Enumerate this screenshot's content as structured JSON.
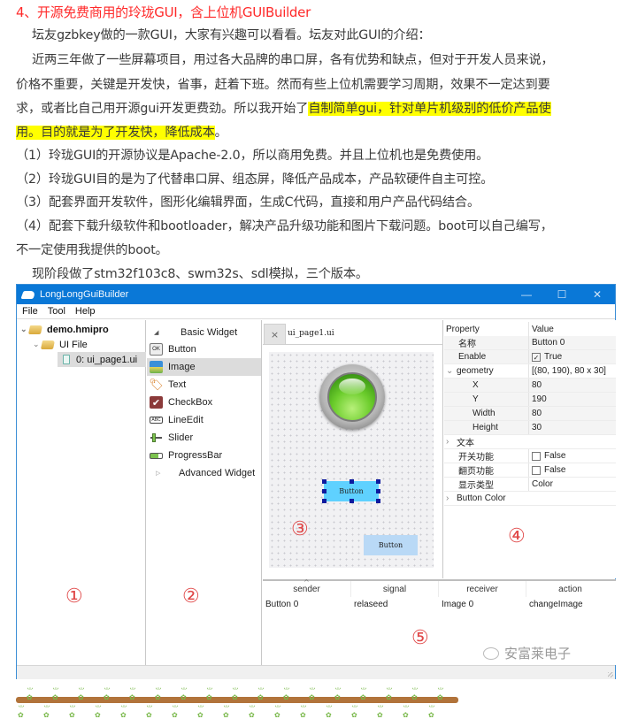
{
  "article": {
    "heading": "4、开源免费商用的玲珑GUI，含上位机GUIBuilder",
    "paragraphs": {
      "intro": "坛友gzbkey做的一款GUI，大家有兴趣可以看看。坛友对此GUI的介绍：",
      "body_line1": "近两三年做了一些屏幕项目，用过各大品牌的串口屏，各有优势和缺点，但对于开发人员来说，",
      "body_line2": "价格不重要，关键是开发快，省事，赶着下班。然而有些上位机需要学习周期，效果不一定达到要",
      "body_line3_plain": "求，或者比自己用开源gui开发更费劲。所以我开始了",
      "body_line3_highlight": "自制简单gui，针对单片机级别的低价产品使",
      "body_line4_highlight": "用。目的就是为了开发快，降低成本",
      "body_line4_end": "。",
      "item1": "（1）玲珑GUI的开源协议是Apache-2.0，所以商用免费。并且上位机也是免费使用。",
      "item2": "（2）玲珑GUI目的是为了代替串口屏、组态屏，降低产品成本，产品软硬件自主可控。",
      "item3": "（3）配套界面开发软件，图形化编辑界面，生成C代码，直接和用户产品代码结合。",
      "item4_line1": "（4）配套下载升级软件和bootloader，解决产品升级功能和图片下载问题。boot可以自己编写，",
      "item4_line2": "不一定使用我提供的boot。",
      "versions": "现阶段做了stm32f103c8、swm32s、sdl模拟，三个版本。"
    },
    "highlight_color": "#ffff00",
    "heading_color": "#ff2a2a"
  },
  "window": {
    "title": "LongLongGuiBuilder",
    "controls": {
      "minimize": "—",
      "maximize": "☐",
      "close": "✕"
    },
    "menu": [
      "File",
      "Tool",
      "Help"
    ],
    "titlebar_color": "#0a78d7",
    "project_tree": {
      "root": "demo.hmipro",
      "folder": "UI File",
      "file": "0: ui_page1.ui"
    },
    "widget_box": {
      "group": "Basic Widget",
      "items": [
        {
          "label": "Button",
          "icon": "ok-button-icon"
        },
        {
          "label": "Image",
          "icon": "image-icon"
        },
        {
          "label": "Text",
          "icon": "tag-icon"
        },
        {
          "label": "CheckBox",
          "icon": "checkbox-icon"
        },
        {
          "label": "LineEdit",
          "icon": "line-edit-icon"
        },
        {
          "label": "Slider",
          "icon": "slider-icon"
        },
        {
          "label": "ProgressBar",
          "icon": "progress-bar-icon"
        }
      ],
      "collapsed_group": "Advanced Widget",
      "selected": "Image"
    },
    "editor": {
      "tab_close": "×",
      "tab_label": "ui_page1.ui",
      "button_selected_label": "Button",
      "button_2_label": "Button"
    },
    "properties": {
      "header_key": "Property",
      "header_value": "Value",
      "rows": [
        {
          "key": "名称",
          "value": "Button 0"
        },
        {
          "key": "Enable",
          "value": "True",
          "checked": true
        },
        {
          "key": "geometry",
          "value": "[(80, 190), 80 x 30]"
        },
        {
          "key": "X",
          "value": "80"
        },
        {
          "key": "Y",
          "value": "190"
        },
        {
          "key": "Width",
          "value": "80"
        },
        {
          "key": "Height",
          "value": "30"
        },
        {
          "key": "文本",
          "value": ""
        },
        {
          "key": "开关功能",
          "value": "False",
          "checked": false
        },
        {
          "key": "翻页功能",
          "value": "False",
          "checked": false
        },
        {
          "key": "显示类型",
          "value": "Color"
        },
        {
          "key": "Button Color",
          "value": ""
        }
      ]
    },
    "signals": {
      "columns": [
        "sender",
        "signal",
        "receiver",
        "action"
      ],
      "rows": [
        [
          "Button 0",
          "relaseed",
          "Image 0",
          "changeImage"
        ]
      ]
    },
    "annotations": [
      "①",
      "②",
      "③",
      "④",
      "⑤"
    ]
  },
  "watermark": "安富莱电子"
}
